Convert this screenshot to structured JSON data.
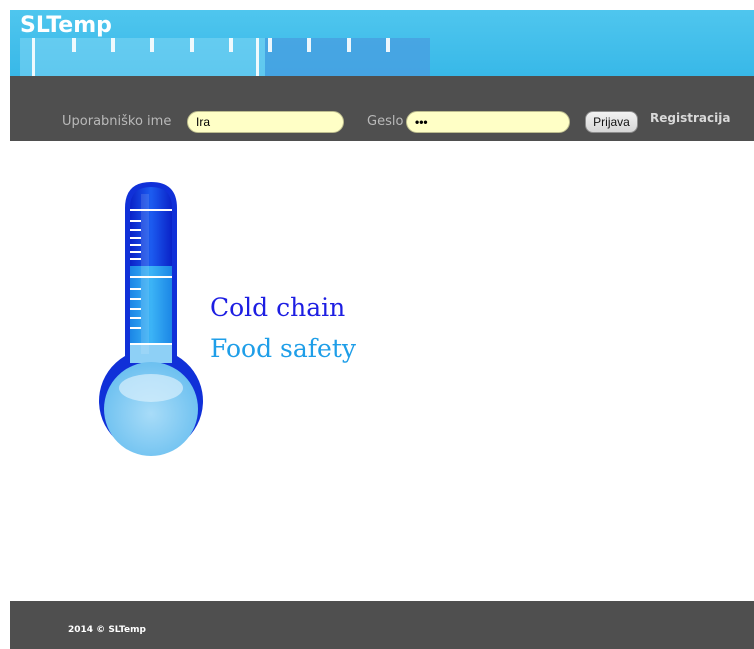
{
  "app": {
    "title": "SLTemp"
  },
  "login": {
    "username_label": "Uporabniško ime",
    "username_value": "Ira",
    "password_label": "Geslo",
    "password_value": "•••",
    "submit_label": "Prijava",
    "register_label": "Registracija"
  },
  "hero": {
    "line1": "Cold chain",
    "line2": "Food safety",
    "line1_color": "#1d1ee2",
    "line2_color": "#1e9ee8"
  },
  "footer": {
    "copyright": "2014  ©  SLTemp"
  },
  "colors": {
    "header_blue": "#38b8e8",
    "bar_gray": "#4f4f4f",
    "field_yellow": "#ffffc6"
  }
}
